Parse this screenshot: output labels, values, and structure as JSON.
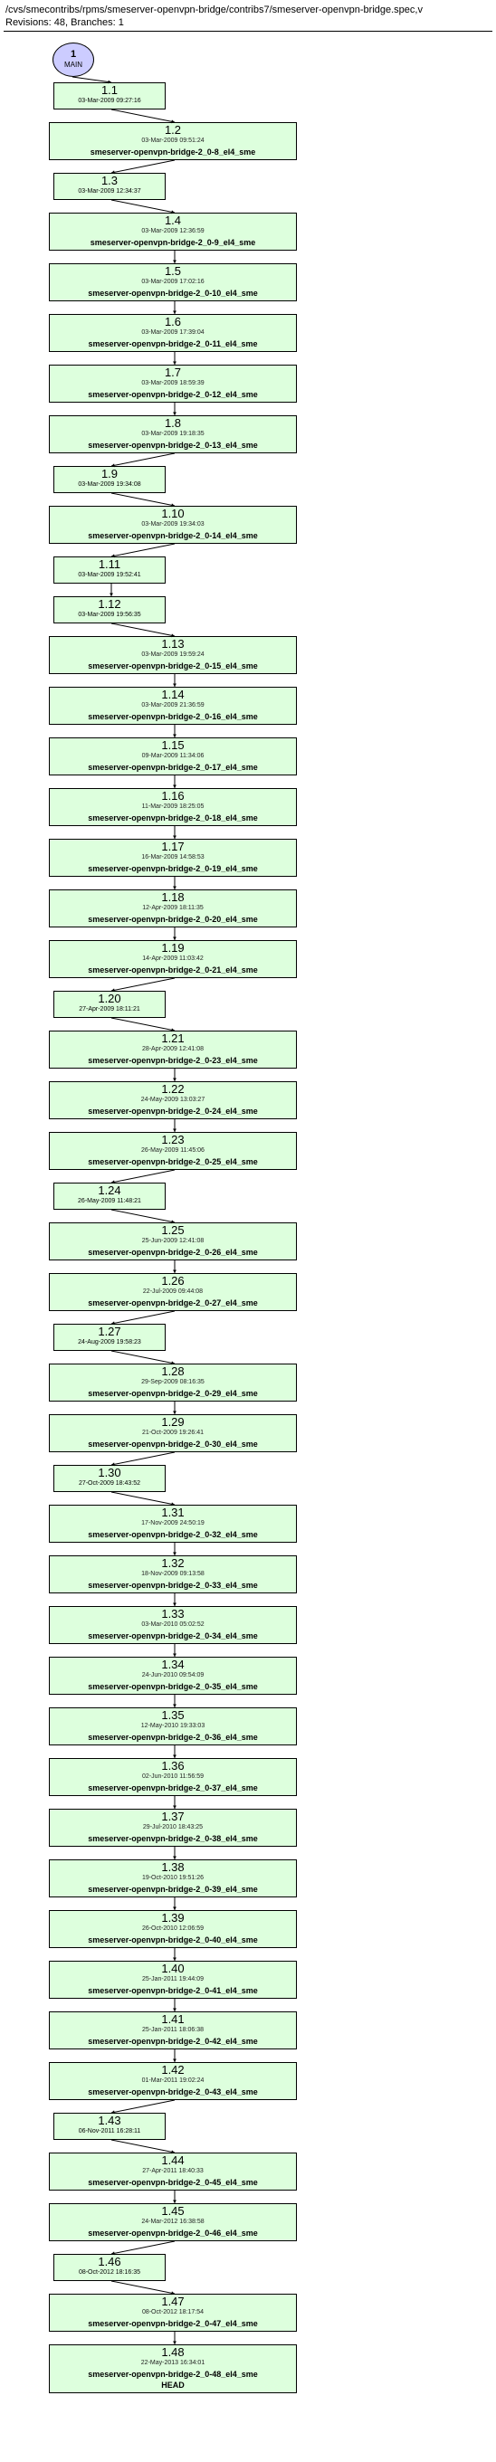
{
  "header": {
    "path": "/cvs/smecontribs/rpms/smeserver-openvpn-bridge/contribs7/smeserver-openvpn-bridge.spec,v",
    "stats": "Revisions: 48, Branches: 1"
  },
  "main": {
    "num": "1",
    "label": "MAIN"
  },
  "nodes": [
    {
      "rev": "1.1",
      "date": "03-Mar-2009 09:27:16",
      "tag": "",
      "small": true
    },
    {
      "rev": "1.2",
      "date": "03-Mar-2009 09:51:24",
      "tag": "smeserver-openvpn-bridge-2_0-8_el4_sme"
    },
    {
      "rev": "1.3",
      "date": "03-Mar-2009 12:34:37",
      "tag": "",
      "small": true
    },
    {
      "rev": "1.4",
      "date": "03-Mar-2009 12:36:59",
      "tag": "smeserver-openvpn-bridge-2_0-9_el4_sme"
    },
    {
      "rev": "1.5",
      "date": "03-Mar-2009 17:02:16",
      "tag": "smeserver-openvpn-bridge-2_0-10_el4_sme"
    },
    {
      "rev": "1.6",
      "date": "03-Mar-2009 17:39:04",
      "tag": "smeserver-openvpn-bridge-2_0-11_el4_sme"
    },
    {
      "rev": "1.7",
      "date": "03-Mar-2009 18:59:39",
      "tag": "smeserver-openvpn-bridge-2_0-12_el4_sme"
    },
    {
      "rev": "1.8",
      "date": "03-Mar-2009 19:18:35",
      "tag": "smeserver-openvpn-bridge-2_0-13_el4_sme"
    },
    {
      "rev": "1.9",
      "date": "03-Mar-2009 19:34:08",
      "tag": "",
      "small": true
    },
    {
      "rev": "1.10",
      "date": "03-Mar-2009 19:34:03",
      "tag": "smeserver-openvpn-bridge-2_0-14_el4_sme"
    },
    {
      "rev": "1.11",
      "date": "03-Mar-2009 19:52:41",
      "tag": "",
      "small": true
    },
    {
      "rev": "1.12",
      "date": "03-Mar-2009 19:56:35",
      "tag": "",
      "small": true
    },
    {
      "rev": "1.13",
      "date": "03-Mar-2009 19:59:24",
      "tag": "smeserver-openvpn-bridge-2_0-15_el4_sme"
    },
    {
      "rev": "1.14",
      "date": "03-Mar-2009 21:36:59",
      "tag": "smeserver-openvpn-bridge-2_0-16_el4_sme"
    },
    {
      "rev": "1.15",
      "date": "09-Mar-2009 11:34:06",
      "tag": "smeserver-openvpn-bridge-2_0-17_el4_sme"
    },
    {
      "rev": "1.16",
      "date": "11-Mar-2009 18:25:05",
      "tag": "smeserver-openvpn-bridge-2_0-18_el4_sme"
    },
    {
      "rev": "1.17",
      "date": "16-Mar-2009 14:58:53",
      "tag": "smeserver-openvpn-bridge-2_0-19_el4_sme"
    },
    {
      "rev": "1.18",
      "date": "12-Apr-2009 18:11:35",
      "tag": "smeserver-openvpn-bridge-2_0-20_el4_sme"
    },
    {
      "rev": "1.19",
      "date": "14-Apr-2009 11:03:42",
      "tag": "smeserver-openvpn-bridge-2_0-21_el4_sme"
    },
    {
      "rev": "1.20",
      "date": "27-Apr-2009 18:11:21",
      "tag": "",
      "small": true
    },
    {
      "rev": "1.21",
      "date": "28-Apr-2009 12:41:08",
      "tag": "smeserver-openvpn-bridge-2_0-23_el4_sme"
    },
    {
      "rev": "1.22",
      "date": "24-May-2009 13:03:27",
      "tag": "smeserver-openvpn-bridge-2_0-24_el4_sme"
    },
    {
      "rev": "1.23",
      "date": "26-May-2009 11:45:06",
      "tag": "smeserver-openvpn-bridge-2_0-25_el4_sme"
    },
    {
      "rev": "1.24",
      "date": "26-May-2009 11:48:21",
      "tag": "",
      "small": true
    },
    {
      "rev": "1.25",
      "date": "25-Jun-2009 12:41:08",
      "tag": "smeserver-openvpn-bridge-2_0-26_el4_sme"
    },
    {
      "rev": "1.26",
      "date": "22-Jul-2009 09:44:08",
      "tag": "smeserver-openvpn-bridge-2_0-27_el4_sme"
    },
    {
      "rev": "1.27",
      "date": "24-Aug-2009 19:58:23",
      "tag": "",
      "small": true
    },
    {
      "rev": "1.28",
      "date": "29-Sep-2009 08:16:35",
      "tag": "smeserver-openvpn-bridge-2_0-29_el4_sme"
    },
    {
      "rev": "1.29",
      "date": "21-Oct-2009 19:26:41",
      "tag": "smeserver-openvpn-bridge-2_0-30_el4_sme"
    },
    {
      "rev": "1.30",
      "date": "27-Oct-2009 18:43:52",
      "tag": "",
      "small": true
    },
    {
      "rev": "1.31",
      "date": "17-Nov-2009 24:50:19",
      "tag": "smeserver-openvpn-bridge-2_0-32_el4_sme"
    },
    {
      "rev": "1.32",
      "date": "18-Nov-2009 09:13:58",
      "tag": "smeserver-openvpn-bridge-2_0-33_el4_sme"
    },
    {
      "rev": "1.33",
      "date": "03-Mar-2010 05:02:52",
      "tag": "smeserver-openvpn-bridge-2_0-34_el4_sme"
    },
    {
      "rev": "1.34",
      "date": "24-Jun-2010 09:54:09",
      "tag": "smeserver-openvpn-bridge-2_0-35_el4_sme"
    },
    {
      "rev": "1.35",
      "date": "12-May-2010 19:33:03",
      "tag": "smeserver-openvpn-bridge-2_0-36_el4_sme"
    },
    {
      "rev": "1.36",
      "date": "02-Jun-2010 11:56:59",
      "tag": "smeserver-openvpn-bridge-2_0-37_el4_sme"
    },
    {
      "rev": "1.37",
      "date": "29-Jul-2010 18:43:25",
      "tag": "smeserver-openvpn-bridge-2_0-38_el4_sme"
    },
    {
      "rev": "1.38",
      "date": "19-Oct-2010 19:51:26",
      "tag": "smeserver-openvpn-bridge-2_0-39_el4_sme"
    },
    {
      "rev": "1.39",
      "date": "26-Oct-2010 12:06:59",
      "tag": "smeserver-openvpn-bridge-2_0-40_el4_sme"
    },
    {
      "rev": "1.40",
      "date": "25-Jan-2011 19:44:09",
      "tag": "smeserver-openvpn-bridge-2_0-41_el4_sme"
    },
    {
      "rev": "1.41",
      "date": "25-Jan-2011 18:06:38",
      "tag": "smeserver-openvpn-bridge-2_0-42_el4_sme"
    },
    {
      "rev": "1.42",
      "date": "01-Mar-2011 19:02:24",
      "tag": "smeserver-openvpn-bridge-2_0-43_el4_sme"
    },
    {
      "rev": "1.43",
      "date": "06-Nov-2011 16:28:11",
      "tag": "",
      "small": true
    },
    {
      "rev": "1.44",
      "date": "27-Apr-2011 18:40:33",
      "tag": "smeserver-openvpn-bridge-2_0-45_el4_sme"
    },
    {
      "rev": "1.45",
      "date": "24-Mar-2012 16:38:58",
      "tag": "smeserver-openvpn-bridge-2_0-46_el4_sme"
    },
    {
      "rev": "1.46",
      "date": "08-Oct-2012 18:16:35",
      "tag": "",
      "small": true
    },
    {
      "rev": "1.47",
      "date": "08-Oct-2012 18:17:54",
      "tag": "smeserver-openvpn-bridge-2_0-47_el4_sme"
    },
    {
      "rev": "1.48",
      "date": "22-May-2013 16:34:01",
      "tag": "smeserver-openvpn-bridge-2_0-48_el4_sme\nHEAD"
    }
  ]
}
